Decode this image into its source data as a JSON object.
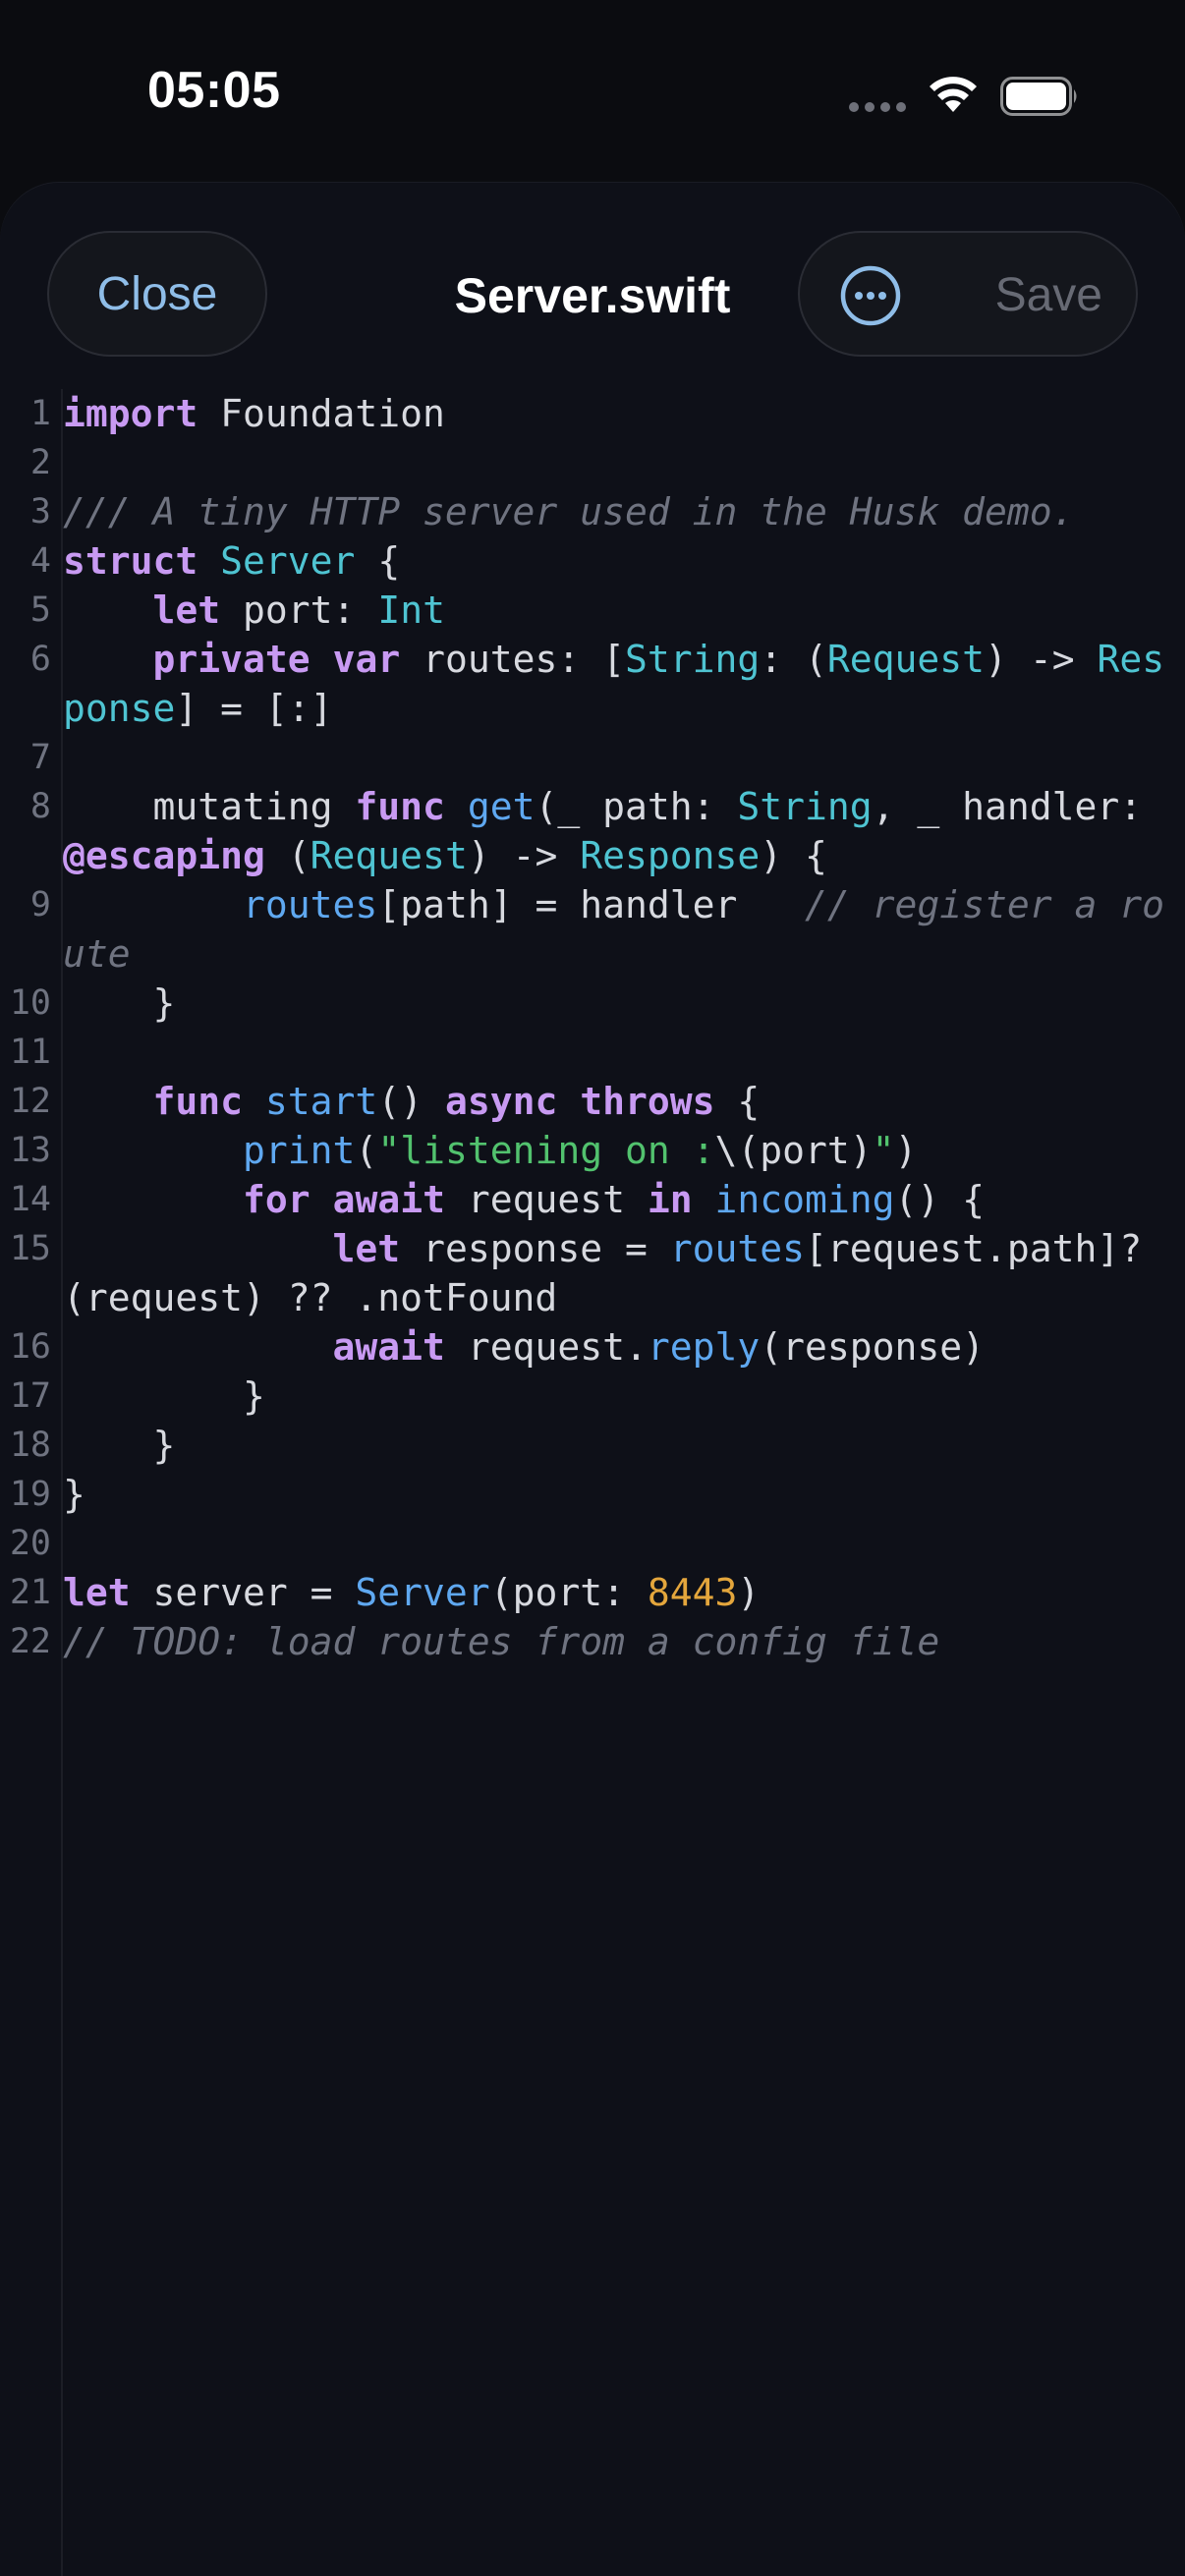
{
  "status_bar": {
    "time": "05:05",
    "icons": [
      "cellular-signal-icon",
      "wifi-icon",
      "battery-icon"
    ]
  },
  "header": {
    "close_label": "Close",
    "title": "Server.swift",
    "more_icon": "ellipsis-circle-icon",
    "save_label": "Save"
  },
  "colors": {
    "keyword": "#c89af2",
    "type": "#4fc4d2",
    "function": "#5fa8f0",
    "string": "#52c26e",
    "number": "#e4a63c",
    "comment": "#6f7380",
    "plain": "#d7d9df",
    "accent": "#8fbde8"
  },
  "editor": {
    "lines": [
      {
        "n": "1",
        "tokens": [
          [
            "kw",
            "import"
          ],
          [
            "pl",
            " Foundation"
          ]
        ]
      },
      {
        "n": "2",
        "tokens": []
      },
      {
        "n": "3",
        "tokens": [
          [
            "cm",
            "/// A tiny HTTP server used in the Husk demo."
          ]
        ]
      },
      {
        "n": "4",
        "tokens": [
          [
            "kw",
            "struct"
          ],
          [
            "pl",
            " "
          ],
          [
            "ty",
            "Server"
          ],
          [
            "pl",
            " {"
          ]
        ]
      },
      {
        "n": "5",
        "tokens": [
          [
            "pl",
            "    "
          ],
          [
            "kw",
            "let"
          ],
          [
            "pl",
            " port: "
          ],
          [
            "ty",
            "Int"
          ]
        ]
      },
      {
        "n": "6",
        "tokens": [
          [
            "pl",
            "    "
          ],
          [
            "kw",
            "private"
          ],
          [
            "pl",
            " "
          ],
          [
            "kw",
            "var"
          ],
          [
            "pl",
            " routes: ["
          ],
          [
            "ty",
            "String"
          ],
          [
            "pl",
            ": ("
          ],
          [
            "ty",
            "Request"
          ],
          [
            "pl",
            ") -> "
          ],
          [
            "ty",
            "Response"
          ],
          [
            "pl",
            "] = [:]"
          ]
        ]
      },
      {
        "n": "7",
        "tokens": []
      },
      {
        "n": "8",
        "tokens": [
          [
            "pl",
            "    mutating "
          ],
          [
            "kw",
            "func"
          ],
          [
            "pl",
            " "
          ],
          [
            "fn",
            "get"
          ],
          [
            "pl",
            "(_ path: "
          ],
          [
            "ty",
            "String"
          ],
          [
            "pl",
            ", _ handler: "
          ],
          [
            "kw",
            "@escaping"
          ],
          [
            "pl",
            " ("
          ],
          [
            "ty",
            "Request"
          ],
          [
            "pl",
            ") -> "
          ],
          [
            "ty",
            "Response"
          ],
          [
            "pl",
            ") {"
          ]
        ]
      },
      {
        "n": "9",
        "tokens": [
          [
            "pl",
            "        "
          ],
          [
            "fn",
            "routes"
          ],
          [
            "pl",
            "[path] = handler   "
          ],
          [
            "cm",
            "// register a route"
          ]
        ]
      },
      {
        "n": "10",
        "tokens": [
          [
            "pl",
            "    }"
          ]
        ]
      },
      {
        "n": "11",
        "tokens": []
      },
      {
        "n": "12",
        "tokens": [
          [
            "pl",
            "    "
          ],
          [
            "kw",
            "func"
          ],
          [
            "pl",
            " "
          ],
          [
            "fn",
            "start"
          ],
          [
            "pl",
            "() "
          ],
          [
            "kw",
            "async"
          ],
          [
            "pl",
            " "
          ],
          [
            "kw",
            "throws"
          ],
          [
            "pl",
            " {"
          ]
        ]
      },
      {
        "n": "13",
        "tokens": [
          [
            "pl",
            "        "
          ],
          [
            "fn",
            "print"
          ],
          [
            "pl",
            "("
          ],
          [
            "str",
            "\"listening on :"
          ],
          [
            "pl",
            "\\(port)"
          ],
          [
            "str",
            "\""
          ],
          [
            "pl",
            ")"
          ]
        ]
      },
      {
        "n": "14",
        "tokens": [
          [
            "pl",
            "        "
          ],
          [
            "kw",
            "for"
          ],
          [
            "pl",
            " "
          ],
          [
            "kw",
            "await"
          ],
          [
            "pl",
            " request "
          ],
          [
            "kw",
            "in"
          ],
          [
            "pl",
            " "
          ],
          [
            "fn",
            "incoming"
          ],
          [
            "pl",
            "() {"
          ]
        ]
      },
      {
        "n": "15",
        "tokens": [
          [
            "pl",
            "            "
          ],
          [
            "kw",
            "let"
          ],
          [
            "pl",
            " response = "
          ],
          [
            "fn",
            "routes"
          ],
          [
            "pl",
            "[request.path]?(request) ?? .notFound"
          ]
        ]
      },
      {
        "n": "16",
        "tokens": [
          [
            "pl",
            "            "
          ],
          [
            "kw",
            "await"
          ],
          [
            "pl",
            " request."
          ],
          [
            "fn",
            "reply"
          ],
          [
            "pl",
            "(response)"
          ]
        ]
      },
      {
        "n": "17",
        "tokens": [
          [
            "pl",
            "        }"
          ]
        ]
      },
      {
        "n": "18",
        "tokens": [
          [
            "pl",
            "    }"
          ]
        ]
      },
      {
        "n": "19",
        "tokens": [
          [
            "pl",
            "}"
          ]
        ]
      },
      {
        "n": "20",
        "tokens": []
      },
      {
        "n": "21",
        "tokens": [
          [
            "kw",
            "let"
          ],
          [
            "pl",
            " server = "
          ],
          [
            "fn",
            "Server"
          ],
          [
            "pl",
            "(port: "
          ],
          [
            "num",
            "8443"
          ],
          [
            "pl",
            ")"
          ]
        ]
      },
      {
        "n": "22",
        "tokens": [
          [
            "cm",
            "// TODO: load routes from a config file"
          ]
        ]
      }
    ]
  }
}
